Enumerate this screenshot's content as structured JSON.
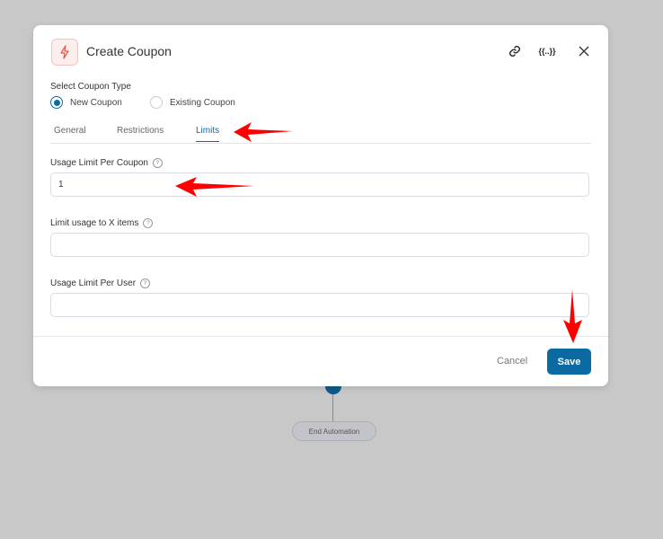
{
  "background": {
    "end_node_label": "End Automation"
  },
  "modal": {
    "title": "Create Coupon",
    "header_icons": [
      "lightning-icon",
      "link-icon",
      "merge-tags-icon",
      "close-icon"
    ],
    "coupon_type": {
      "label": "Select Coupon Type",
      "options": [
        {
          "label": "New Coupon",
          "selected": true
        },
        {
          "label": "Existing Coupon",
          "selected": false
        }
      ]
    },
    "tabs": [
      {
        "label": "General",
        "active": false
      },
      {
        "label": "Restrictions",
        "active": false
      },
      {
        "label": "Limits",
        "active": true
      }
    ],
    "fields": [
      {
        "label": "Usage Limit Per Coupon",
        "value": "1",
        "placeholder": ""
      },
      {
        "label": "Limit usage to X items",
        "value": "",
        "placeholder": ""
      },
      {
        "label": "Usage Limit Per User",
        "value": "",
        "placeholder": ""
      }
    ],
    "help_glyph": "?",
    "footer": {
      "cancel_label": "Cancel",
      "save_label": "Save"
    }
  },
  "colors": {
    "accent": "#0b6aa2",
    "annotation_arrow": "#ff0000",
    "overlay": "#c8c8c8"
  }
}
